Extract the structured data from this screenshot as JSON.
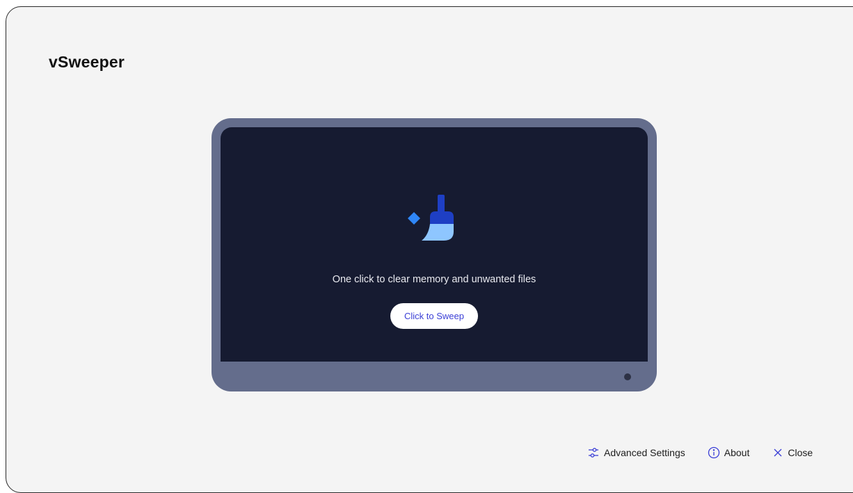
{
  "app": {
    "title": "vSweeper"
  },
  "main": {
    "tagline": "One click to clear memory and unwanted files",
    "sweep_button_label": "Click to Sweep",
    "hero_icon": "broom-icon"
  },
  "footer": {
    "advanced_settings": {
      "label": "Advanced Settings",
      "icon": "sliders-icon"
    },
    "about": {
      "label": "About",
      "icon": "info-icon"
    },
    "close": {
      "label": "Close",
      "icon": "close-icon"
    }
  },
  "colors": {
    "accent": "#3b3fd6",
    "brand_blue": "#1e3fc4",
    "light_blue": "#8ec6ff",
    "sparkle_blue": "#2f86f6",
    "device_frame": "#646d8c",
    "screen_bg": "#161b31",
    "window_bg": "#f4f4f4"
  }
}
